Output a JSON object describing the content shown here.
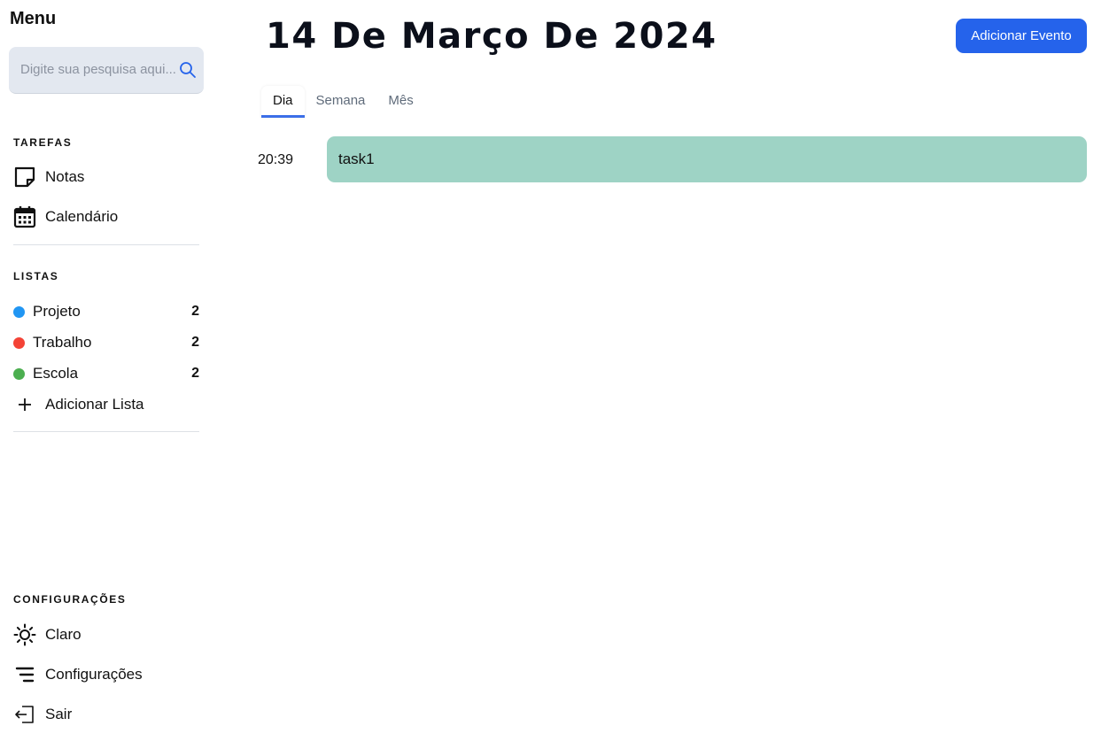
{
  "sidebar": {
    "title": "Menu",
    "search": {
      "placeholder": "Digite sua pesquisa aqui...",
      "value": ""
    },
    "tasks_section": {
      "title": "TAREFAS",
      "items": [
        {
          "label": "Notas",
          "icon": "note-icon"
        },
        {
          "label": "Calendário",
          "icon": "calendar-icon"
        }
      ]
    },
    "lists_section": {
      "title": "LISTAS",
      "items": [
        {
          "label": "Projeto",
          "count": "2",
          "color": "#2196f3"
        },
        {
          "label": "Trabalho",
          "count": "2",
          "color": "#f44336"
        },
        {
          "label": "Escola",
          "count": "2",
          "color": "#4caf50"
        }
      ],
      "add_label": "Adicionar Lista"
    },
    "settings_section": {
      "title": "CONFIGURAÇÕES",
      "items": [
        {
          "label": "Claro",
          "icon": "sun-icon"
        },
        {
          "label": "Configurações",
          "icon": "settings-lines-icon"
        },
        {
          "label": "Sair",
          "icon": "logout-icon"
        }
      ]
    }
  },
  "main": {
    "date_title": "14 De Março De 2024",
    "add_event_label": "Adicionar Evento",
    "accent_color": "#2563eb",
    "tabs": [
      {
        "label": "Dia",
        "active": true
      },
      {
        "label": "Semana",
        "active": false
      },
      {
        "label": "Mês",
        "active": false
      }
    ],
    "events": [
      {
        "time": "20:39",
        "title": "task1",
        "color": "#9ed3c5"
      }
    ]
  }
}
